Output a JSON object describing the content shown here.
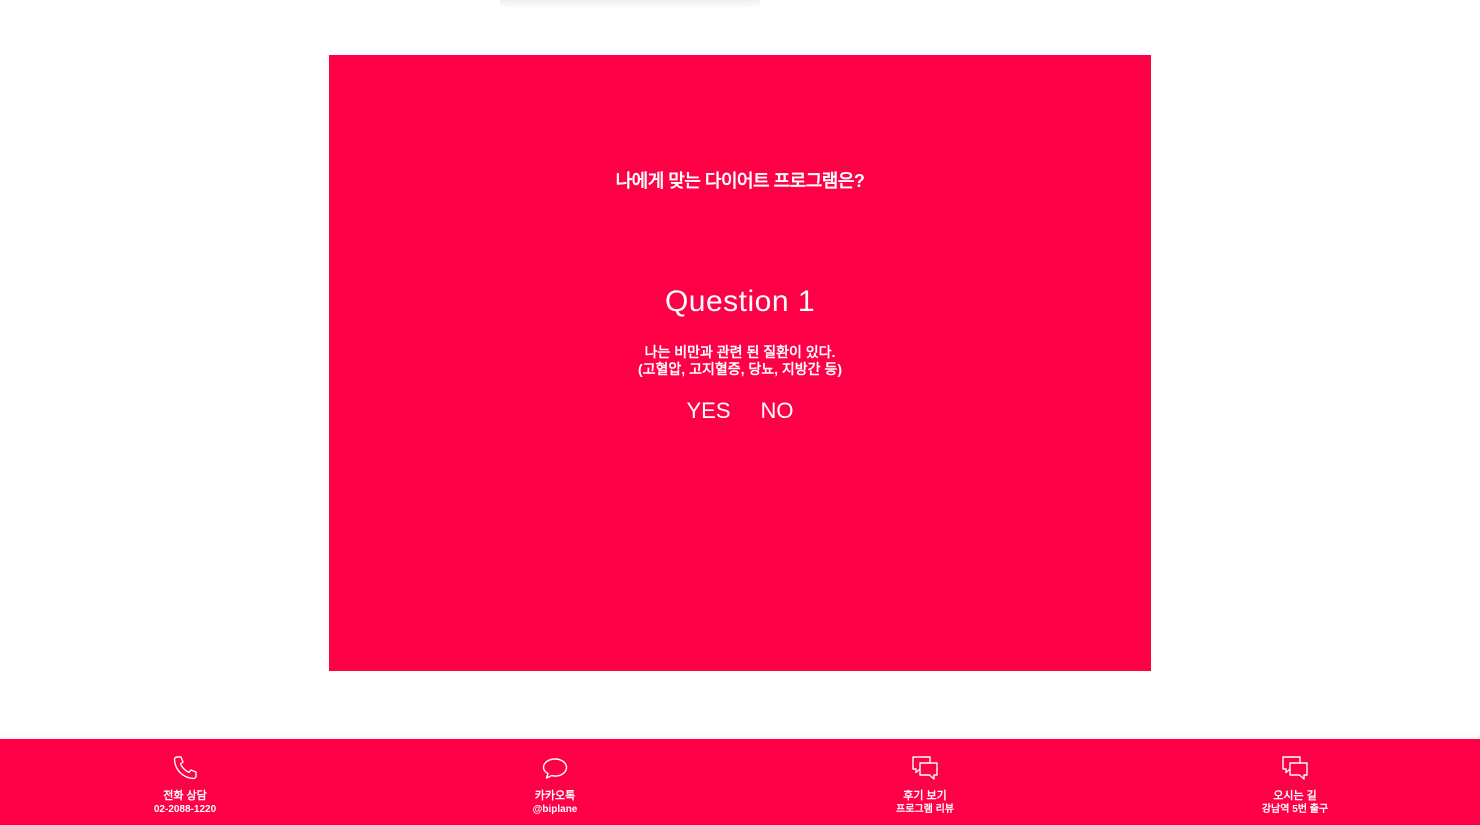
{
  "quiz": {
    "title": "나에게 맞는 다이어트 프로그램은?",
    "question_number": "Question 1",
    "question_line1": "나는 비만과 관련 된 질환이 있다.",
    "question_line2": "(고혈압, 고지혈증, 당뇨, 지방간 등)",
    "yes_label": "YES",
    "no_label": "NO"
  },
  "bottom_bar": {
    "items": [
      {
        "icon": "phone-icon",
        "label": "전화 상담",
        "sub": "02-2088-1220"
      },
      {
        "icon": "chat-bubble-icon",
        "label": "카카오톡",
        "sub": "@biplane"
      },
      {
        "icon": "reviews-icon",
        "label": "후기 보기",
        "sub": "프로그램 리뷰"
      },
      {
        "icon": "directions-icon",
        "label": "오시는 길",
        "sub": "강남역 5번 출구"
      }
    ]
  },
  "colors": {
    "accent": "#ff0046",
    "text_on_accent": "#ffffff",
    "background": "#ffffff"
  }
}
